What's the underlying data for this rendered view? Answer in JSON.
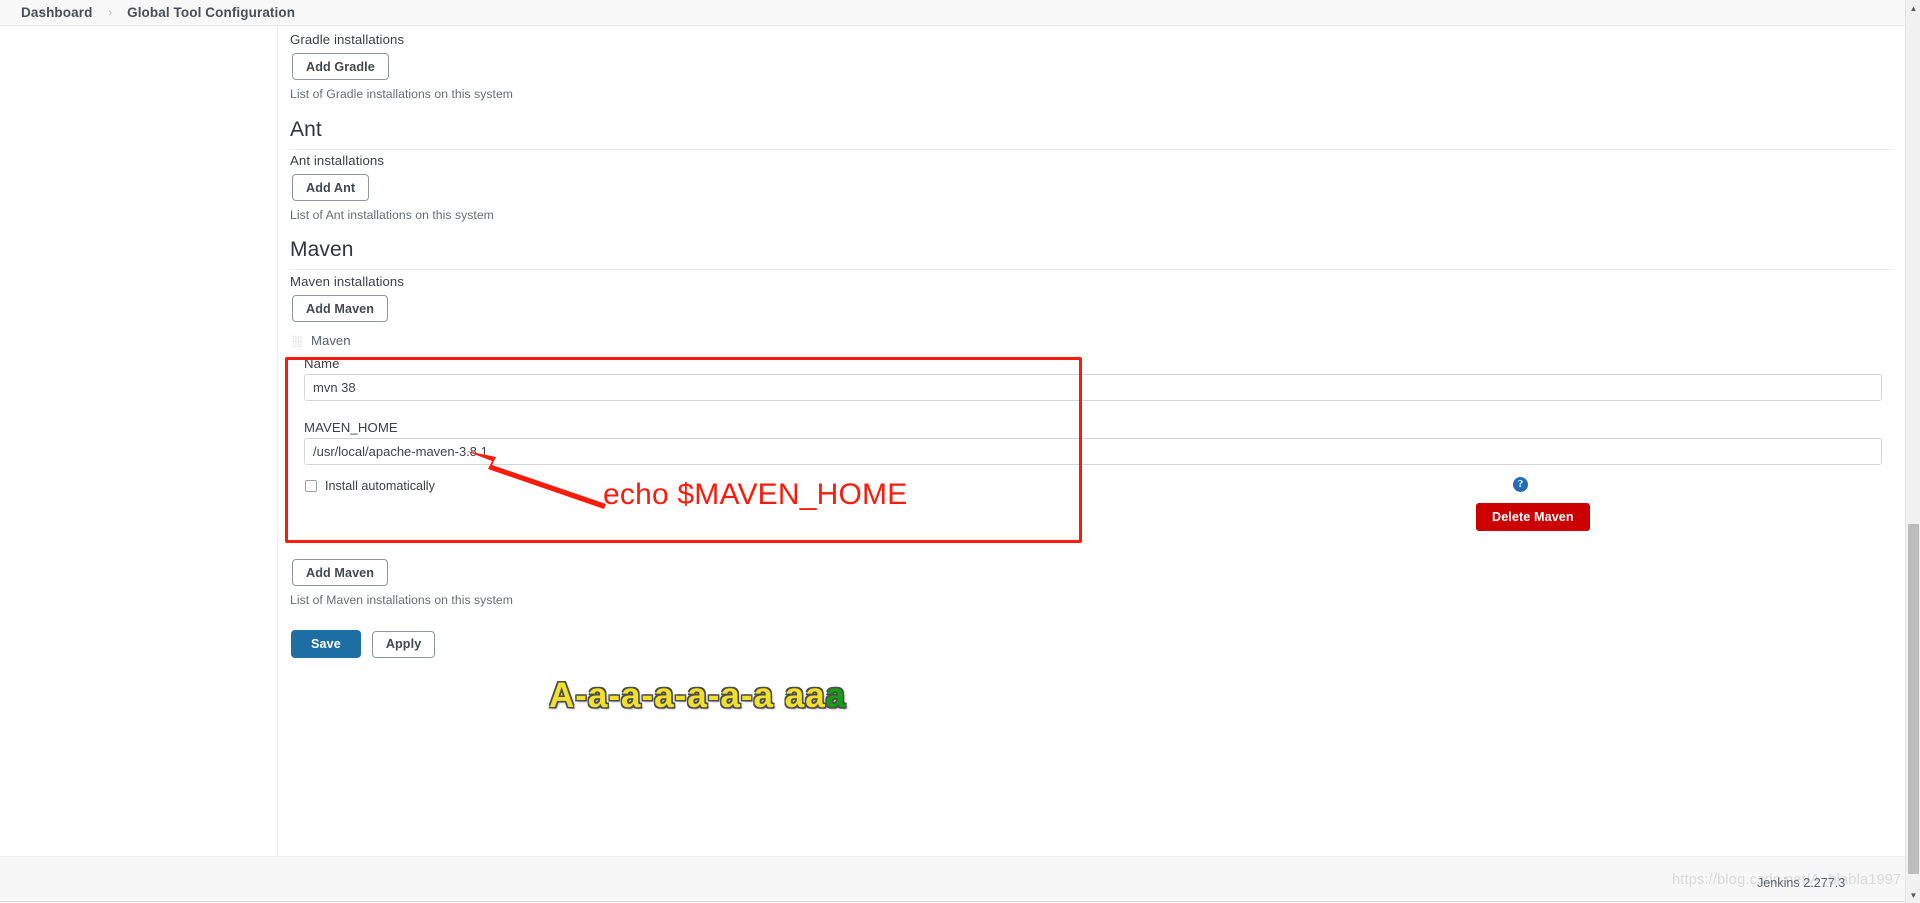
{
  "breadcrumb": {
    "items": [
      {
        "label": "Dashboard",
        "name": "breadcrumb-dashboard"
      },
      {
        "label": "Global Tool Configuration",
        "name": "breadcrumb-current"
      }
    ],
    "separator": "›"
  },
  "sections": {
    "gradle": {
      "installations_label": "Gradle installations",
      "add_button": "Add Gradle",
      "help_text": "List of Gradle installations on this system"
    },
    "ant": {
      "title": "Ant",
      "installations_label": "Ant installations",
      "add_button": "Add Ant",
      "help_text": "List of Ant installations on this system"
    },
    "maven": {
      "title": "Maven",
      "installations_label": "Maven installations",
      "add_button_top": "Add Maven",
      "add_button_bottom": "Add Maven",
      "help_text": "List of Maven installations on this system",
      "entry": {
        "entry_label": "Maven",
        "drag_handle_icon": "drag-grip-icon",
        "name_field": {
          "label": "Name",
          "value": "mvn 38",
          "placeholder": ""
        },
        "home_field": {
          "label": "MAVEN_HOME",
          "value": "/usr/local/apache-maven-3.8.1",
          "placeholder": ""
        },
        "install_automatically": {
          "label": "Install automatically",
          "checked": false
        },
        "help_icon": "question-mark-help-icon",
        "delete_button": "Delete Maven"
      }
    }
  },
  "form_actions": {
    "save_label": "Save",
    "apply_label": "Apply"
  },
  "annotation": {
    "command_text": "echo $MAVEN_HOME",
    "color": "#fb1b0c",
    "arrow_icon": "red-arrow-pointing-upleft-icon",
    "highlight_box_color": "#fb1b0c"
  },
  "watermarks": {
    "yellow_text_main": "A-a-a-a-a-a-a aa",
    "yellow_text_tail": "a",
    "yellow_color": "#f2e02a",
    "tail_color": "#12a013",
    "csdn_text": "https://blog.csdn.net/A_blabla1997"
  },
  "footer": {
    "jenkins_version": "Jenkins 2.277.3"
  },
  "scrollbar": {
    "up_arrow_icon": "scroll-up-arrow-icon",
    "down_arrow_icon": "scroll-down-arrow-icon"
  }
}
